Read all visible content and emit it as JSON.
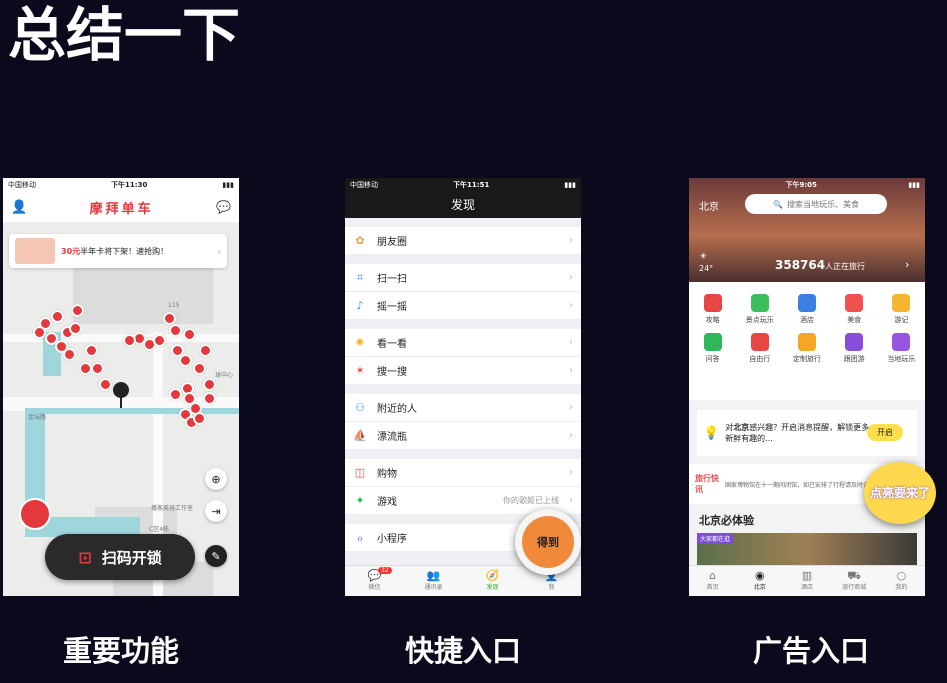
{
  "slide_title": "总结一下",
  "captions": [
    "重要功能",
    "快捷入口",
    "广告入口"
  ],
  "phone1": {
    "carrier": "中国移动",
    "time": "下午11:30",
    "logo": "摩拜单车",
    "promo_highlight": "30元",
    "promo_text": "半年卡将下架！速抢购！",
    "map_labels": [
      "115",
      "金坛路",
      "C区4栋",
      "播客美容工作室",
      "球中心"
    ],
    "unlock_label": "扫码开锁"
  },
  "phone2": {
    "carrier": "中国移动",
    "time": "下午11:51",
    "title": "发现",
    "groups": [
      [
        {
          "icon": "moments-icon",
          "label": "朋友圈"
        }
      ],
      [
        {
          "icon": "scan-icon",
          "label": "扫一扫"
        },
        {
          "icon": "shake-icon",
          "label": "摇一摇"
        }
      ],
      [
        {
          "icon": "top-stories-icon",
          "label": "看一看"
        },
        {
          "icon": "search-icon",
          "label": "搜一搜"
        }
      ],
      [
        {
          "icon": "people-nearby-icon",
          "label": "附近的人"
        },
        {
          "icon": "drift-bottle-icon",
          "label": "漂流瓶"
        }
      ],
      [
        {
          "icon": "shopping-icon",
          "label": "购物"
        },
        {
          "icon": "games-icon",
          "label": "游戏",
          "hint": "你的歌姬已上线"
        }
      ],
      [
        {
          "icon": "mini-program-icon",
          "label": "小程序"
        }
      ]
    ],
    "tabs": [
      "微信",
      "通讯录",
      "发现",
      "我"
    ],
    "chat_badge": "32",
    "floating_label": "得到"
  },
  "phone3": {
    "city": "北京",
    "time": "下午9:05",
    "search_placeholder": "搜索当地玩乐、美食",
    "temperature": "24°",
    "travelers": "358764",
    "travelers_label": "人正在旅行",
    "grid": [
      {
        "label": "攻略",
        "color": "#e84545"
      },
      {
        "label": "景点玩乐",
        "color": "#3cbf5c"
      },
      {
        "label": "酒店",
        "color": "#3b7fe0"
      },
      {
        "label": "美食",
        "color": "#f05050"
      },
      {
        "label": "游记",
        "color": "#f5b731"
      },
      {
        "label": "问答",
        "color": "#2fb85a"
      },
      {
        "label": "自由行",
        "color": "#e84545"
      },
      {
        "label": "定制旅行",
        "color": "#f5a623"
      },
      {
        "label": "跟团游",
        "color": "#8a4fd8"
      },
      {
        "label": "当地玩乐",
        "color": "#9a55e0"
      }
    ],
    "notice_pre": "对",
    "notice_city": "北京",
    "notice_text": "感兴趣？开启消息提醒，解锁更多新鲜有趣的...",
    "notice_button": "开启",
    "news_tag": "旅行快讯",
    "news_text": "国家博物馆在十一期间闭馆，如已安排了行程请及时调整。",
    "section_title": "北京必体验",
    "section_tag": "大家都在逛",
    "tabs": [
      "首页",
      "北京",
      "酒店",
      "旅行商城",
      "我的"
    ],
    "ad_label": "点亮要来了"
  }
}
